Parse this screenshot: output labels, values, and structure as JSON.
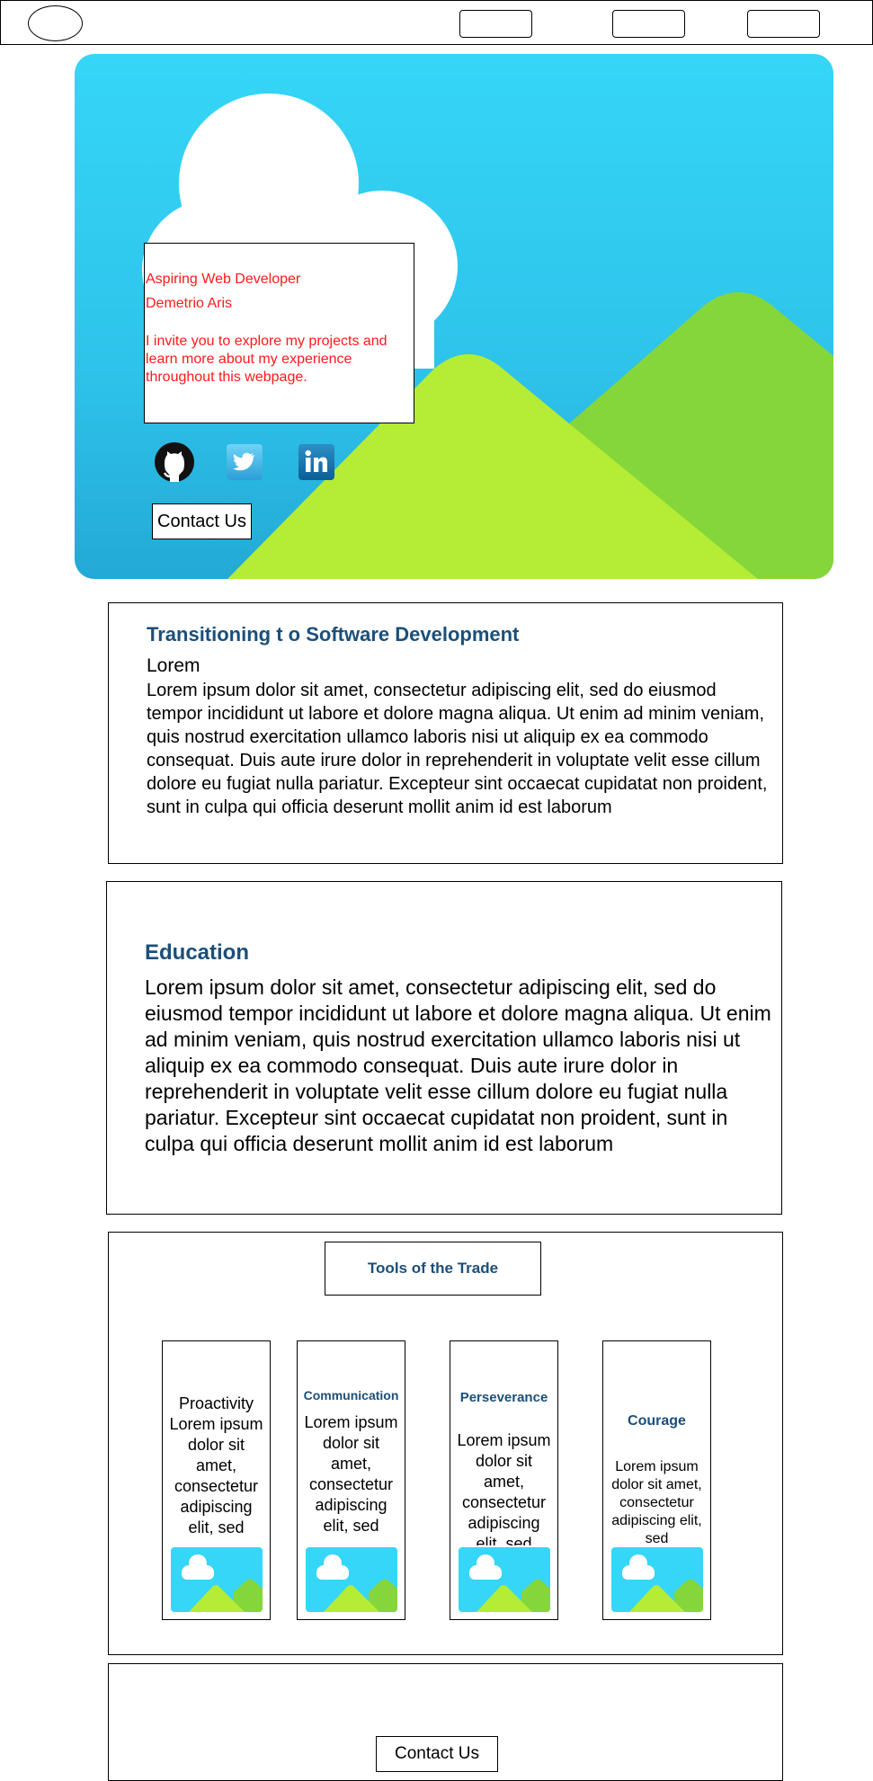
{
  "hero": {
    "role": "Aspiring Web Developer",
    "name": "Demetrio Aris",
    "intro": "I invite you to explore my projects and learn more about my experience throughout this webpage.",
    "contact_label": "Contact Us",
    "social": [
      "github-icon",
      "twitter-icon",
      "linkedin-icon"
    ]
  },
  "section1": {
    "title": "Transitioning t o Software Development",
    "subtitle": "Lorem",
    "body": "Lorem ipsum dolor sit amet, consectetur adipiscing elit, sed do eiusmod tempor incididunt ut labore et dolore magna aliqua. Ut enim ad minim veniam, quis nostrud exercitation ullamco laboris nisi ut aliquip ex ea commodo consequat. Duis aute irure dolor in reprehenderit in voluptate velit esse cillum dolore eu fugiat nulla pariatur. Excepteur sint occaecat cupidatat non proident, sunt in culpa qui officia deserunt mollit anim id est laborum"
  },
  "section2": {
    "title": "Education",
    "body": "Lorem ipsum dolor sit amet, consectetur adipiscing elit, sed do eiusmod tempor incididunt ut labore et dolore magna aliqua. Ut enim ad minim veniam, quis nostrud exercitation ullamco laboris nisi ut aliquip ex ea commodo consequat. Duis aute irure dolor in reprehenderit in voluptate velit esse cillum dolore eu fugiat nulla pariatur. Excepteur sint occaecat cupidatat non proident, sunt in culpa qui officia deserunt mollit anim id est laborum"
  },
  "tools": {
    "title": "Tools of the Trade",
    "cards": [
      {
        "title": "Proactivity",
        "body": "Lorem ipsum dolor sit amet, consectetur adipiscing elit, sed"
      },
      {
        "title": "Communication",
        "body": "Lorem ipsum dolor sit amet, consectetur adipiscing elit, sed"
      },
      {
        "title": "Perseverance",
        "body": "Lorem ipsum dolor sit amet, consectetur adipiscing elit, sed"
      },
      {
        "title": "Courage",
        "body": "Lorem ipsum dolor sit amet, consectetur adipiscing elit, sed"
      }
    ]
  },
  "footer": {
    "contact_label": "Contact Us"
  },
  "colors": {
    "heading": "#1b4f7a",
    "accent_red": "#ff1a1a",
    "sky": "#35d6f7",
    "hill_light": "#b4ec36",
    "hill_dark": "#84d63a"
  }
}
